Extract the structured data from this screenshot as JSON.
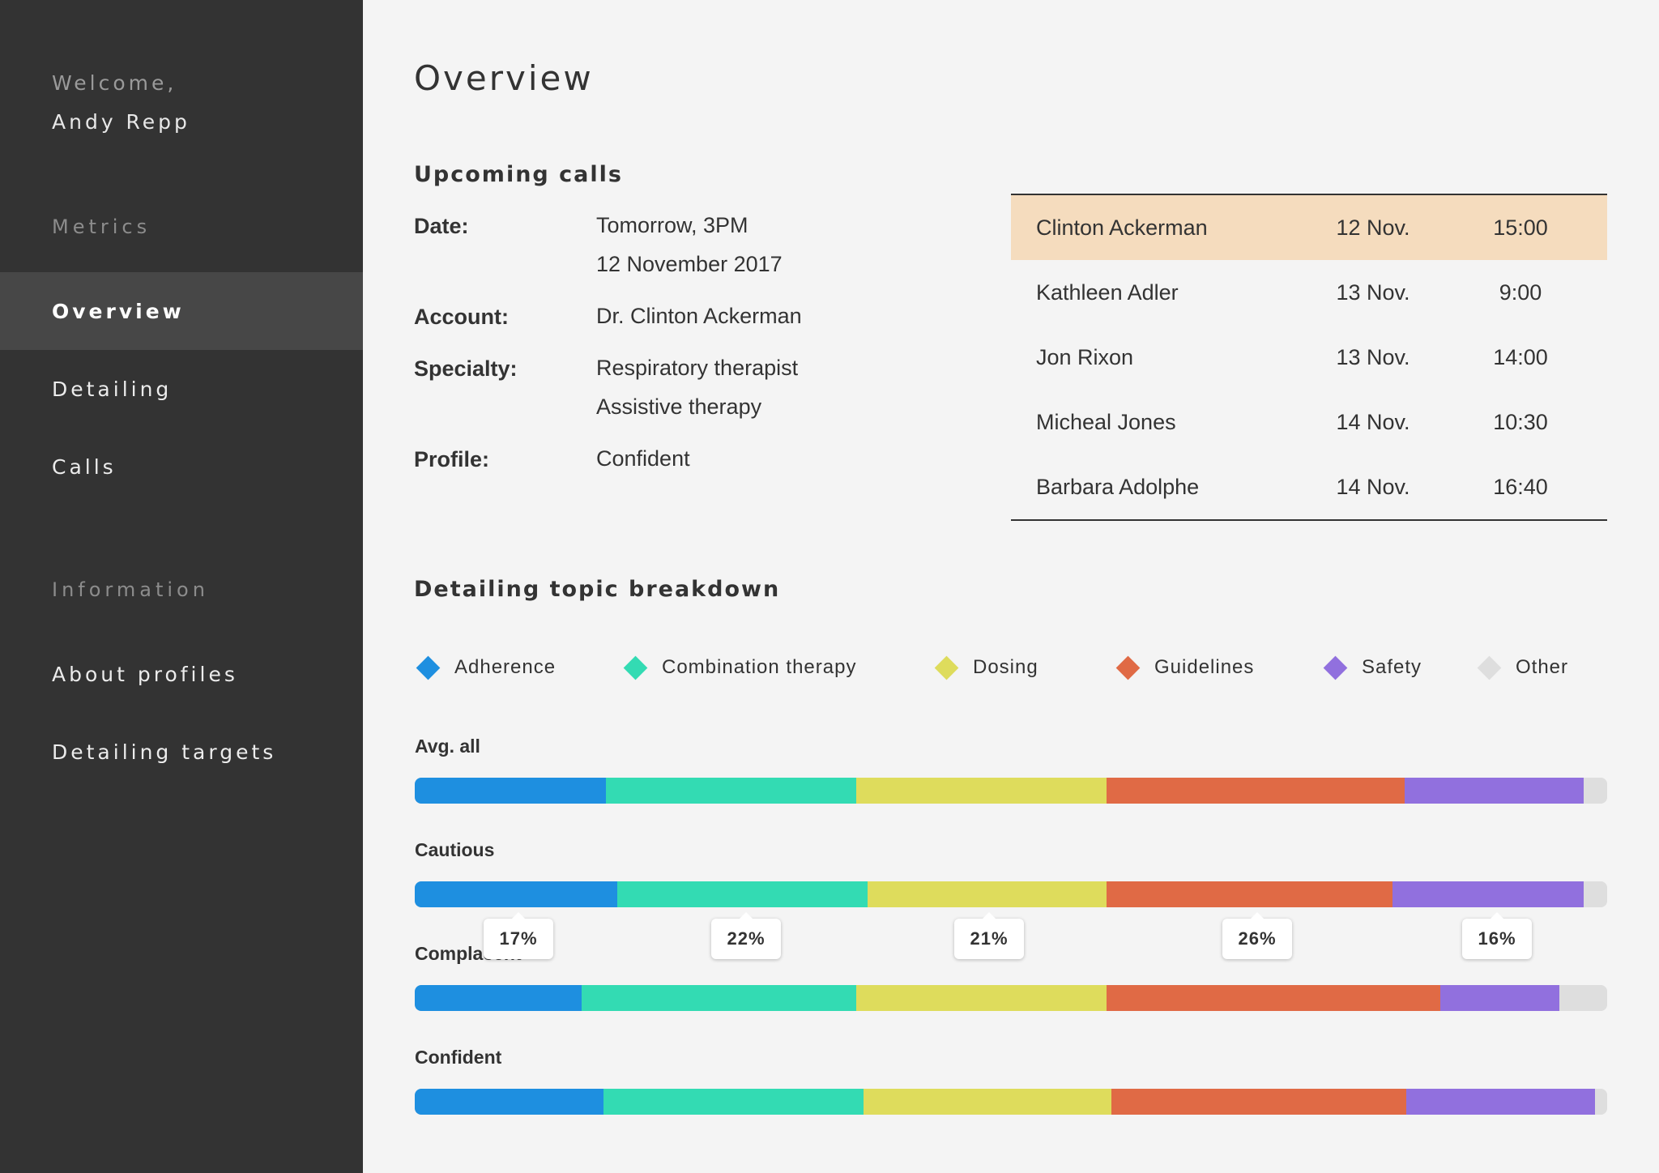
{
  "sidebar": {
    "welcome": "Welcome,",
    "username": "Andy Repp",
    "metrics_heading": "Metrics",
    "metrics_items": [
      {
        "label": "Overview",
        "active": true
      },
      {
        "label": "Detailing",
        "active": false
      },
      {
        "label": "Calls",
        "active": false
      }
    ],
    "information_heading": "Information",
    "information_items": [
      {
        "label": "About profiles"
      },
      {
        "label": "Detailing targets"
      }
    ]
  },
  "main": {
    "title": "Overview",
    "upcoming": {
      "heading": "Upcoming calls",
      "details": [
        {
          "label": "Date:",
          "value_lines": [
            "Tomorrow, 3PM",
            "12 November 2017"
          ]
        },
        {
          "label": "Account:",
          "value_lines": [
            "Dr. Clinton Ackerman"
          ]
        },
        {
          "label": "Specialty:",
          "value_lines": [
            "Respiratory therapist",
            "Assistive therapy"
          ]
        },
        {
          "label": "Profile:",
          "value_lines": [
            "Confident"
          ]
        }
      ],
      "calls": [
        {
          "name": "Clinton Ackerman",
          "date": "12 Nov.",
          "time": "15:00",
          "selected": true
        },
        {
          "name": "Kathleen Adler",
          "date": "13 Nov.",
          "time": "9:00",
          "selected": false
        },
        {
          "name": "Jon Rixon",
          "date": "13 Nov.",
          "time": "14:00",
          "selected": false
        },
        {
          "name": "Micheal Jones",
          "date": "14 Nov.",
          "time": "10:30",
          "selected": false
        },
        {
          "name": "Barbara Adolphe",
          "date": "14 Nov.",
          "time": "16:40",
          "selected": false
        }
      ]
    },
    "breakdown": {
      "heading": "Detailing topic breakdown"
    }
  },
  "chart_data": {
    "type": "bar",
    "orientation": "horizontal-stacked-100",
    "title": "Detailing topic breakdown",
    "legend": [
      {
        "name": "Adherence",
        "color": "#1e8fe0"
      },
      {
        "name": "Combination therapy",
        "color": "#33dbb3"
      },
      {
        "name": "Dosing",
        "color": "#dedc5c"
      },
      {
        "name": "Guidelines",
        "color": "#e06a45"
      },
      {
        "name": "Safety",
        "color": "#9170de"
      },
      {
        "name": "Other",
        "color": "#dedede"
      }
    ],
    "categories": [
      "Avg. all",
      "Cautious",
      "Complacent",
      "Confident"
    ],
    "series": [
      {
        "name": "Adherence",
        "values": [
          16,
          17,
          14,
          16
        ]
      },
      {
        "name": "Combination therapy",
        "values": [
          21,
          21,
          23,
          22
        ]
      },
      {
        "name": "Dosing",
        "values": [
          21,
          20,
          21,
          21
        ]
      },
      {
        "name": "Guidelines",
        "values": [
          25,
          24,
          28,
          25
        ]
      },
      {
        "name": "Safety",
        "values": [
          15,
          16,
          10,
          16
        ]
      },
      {
        "name": "Other",
        "values": [
          2,
          2,
          4,
          1
        ]
      }
    ],
    "tooltip": {
      "category": "Cautious",
      "labels": [
        "17%",
        "22%",
        "21%",
        "26%",
        "16%"
      ]
    }
  }
}
